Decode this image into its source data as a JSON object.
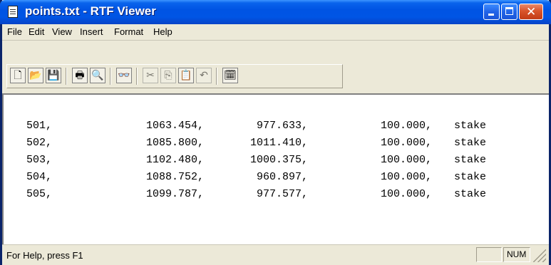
{
  "window": {
    "title": "points.txt - RTF Viewer"
  },
  "menu": [
    "File",
    "Edit",
    "View",
    "Insert",
    "Format",
    "Help"
  ],
  "toolbar": {
    "tools": [
      {
        "name": "new-document-icon",
        "glyph": "🗋",
        "enabled": true
      },
      {
        "name": "open-folder-icon",
        "glyph": "📂",
        "enabled": true
      },
      {
        "name": "save-disk-icon",
        "glyph": "💾",
        "enabled": true
      },
      {
        "name": "print-icon",
        "glyph": "🖶",
        "enabled": true
      },
      {
        "name": "print-preview-icon",
        "glyph": "🔍",
        "enabled": true
      },
      {
        "name": "find-binoculars-icon",
        "glyph": "👓",
        "enabled": true
      },
      {
        "name": "cut-scissors-icon",
        "glyph": "✂",
        "enabled": false
      },
      {
        "name": "copy-icon",
        "glyph": "⎘",
        "enabled": false
      },
      {
        "name": "paste-clipboard-icon",
        "glyph": "📋",
        "enabled": true
      },
      {
        "name": "undo-icon",
        "glyph": "↶",
        "enabled": false
      },
      {
        "name": "insert-datetime-icon",
        "glyph": "🗓",
        "enabled": true
      }
    ]
  },
  "document": {
    "rows": [
      {
        "id": "501,",
        "x": "1063.454,",
        "y": "977.633,",
        "z": "100.000,",
        "desc": "stake"
      },
      {
        "id": "502,",
        "x": "1085.800,",
        "y": "1011.410,",
        "z": "100.000,",
        "desc": "stake"
      },
      {
        "id": "503,",
        "x": "1102.480,",
        "y": "1000.375,",
        "z": "100.000,",
        "desc": "stake"
      },
      {
        "id": "504,",
        "x": "1088.752,",
        "y": "960.897,",
        "z": "100.000,",
        "desc": "stake"
      },
      {
        "id": "505,",
        "x": "1099.787,",
        "y": "977.577,",
        "z": "100.000,",
        "desc": "stake"
      }
    ]
  },
  "status": {
    "help_text": "For Help, press F1",
    "num_indicator": "NUM"
  }
}
